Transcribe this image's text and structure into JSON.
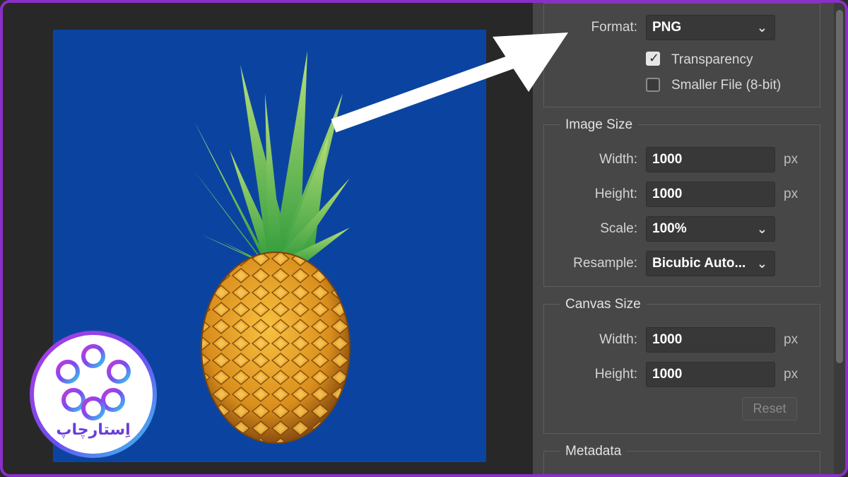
{
  "export_settings": {
    "format": {
      "label": "Format:",
      "value": "PNG"
    },
    "transparency": {
      "label": "Transparency",
      "checked": true
    },
    "smaller_file": {
      "label": "Smaller File (8-bit)",
      "checked": false
    },
    "image_size": {
      "title": "Image Size",
      "width_label": "Width:",
      "width_value": "1000",
      "height_label": "Height:",
      "height_value": "1000",
      "scale_label": "Scale:",
      "scale_value": "100%",
      "resample_label": "Resample:",
      "resample_value": "Bicubic Auto...",
      "unit": "px"
    },
    "canvas_size": {
      "title": "Canvas Size",
      "width_label": "Width:",
      "width_value": "1000",
      "height_label": "Height:",
      "height_value": "1000",
      "unit": "px",
      "reset_label": "Reset"
    },
    "metadata": {
      "title": "Metadata"
    }
  },
  "logo": {
    "text": "اِستارچاپ"
  },
  "colors": {
    "preview_background": "#0b44a0",
    "frame_border": "#8b2fc9",
    "panel_background": "#474747"
  }
}
